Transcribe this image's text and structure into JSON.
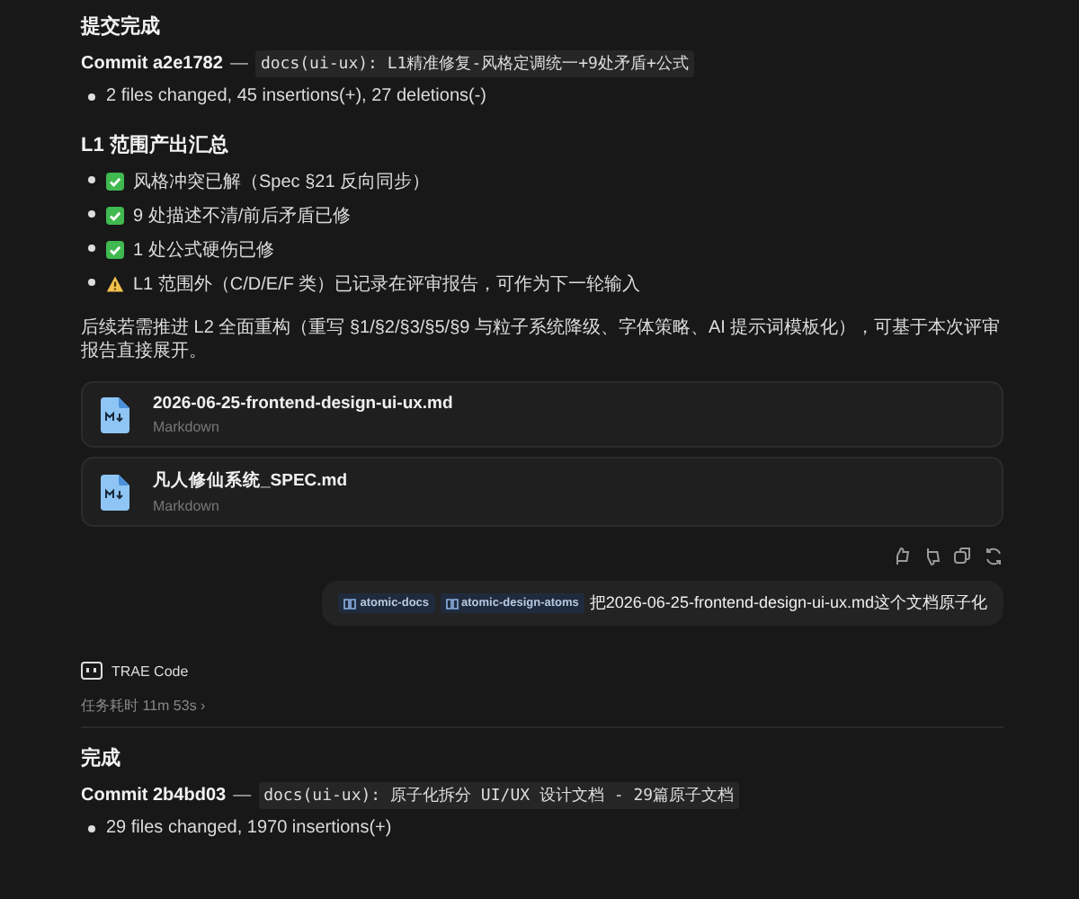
{
  "sections": [
    {
      "heading": "提交完成",
      "commit": {
        "label": "Commit a2e1782",
        "dash": "—",
        "message": "docs(ui-ux): L1精准修复-风格定调统一+9处矛盾+公式"
      },
      "stats": [
        "2 files changed, 45 insertions(+), 27 deletions(-)"
      ]
    }
  ],
  "summary": {
    "heading": "L1 范围产出汇总",
    "items": [
      {
        "kind": "done",
        "text": "风格冲突已解（Spec §21 反向同步）"
      },
      {
        "kind": "done",
        "text": "9 处描述不清/前后矛盾已修"
      },
      {
        "kind": "done",
        "text": "1 处公式硬伤已修"
      },
      {
        "kind": "warning",
        "text": "L1 范围外（C/D/E/F 类）已记录在评审报告，可作为下一轮输入"
      }
    ],
    "note": "后续若需推进 L2 全面重构（重写 §1/§2/§3/§5/§9 与粒子系统降级、字体策略、AI 提示词模板化），可基于本次评审报告直接展开。"
  },
  "files": [
    {
      "name": "2026-06-25-frontend-design-ui-ux.md",
      "type": "Markdown"
    },
    {
      "name": "凡人修仙系统_SPEC.md",
      "type": "Markdown"
    }
  ],
  "user_message": {
    "tags": [
      "atomic-docs",
      "atomic-design-atoms"
    ],
    "text": "把2026-06-25-frontend-design-ui-ux.md这个文档原子化"
  },
  "agent": {
    "name": "TRAE Code",
    "duration": "任务耗时 11m 53s",
    "expand": "›"
  },
  "result": {
    "heading": "完成",
    "commit": {
      "label": "Commit 2b4bd03",
      "dash": "—",
      "message": "docs(ui-ux): 原子化拆分 UI/UX 设计文档 - 29篇原子文档"
    },
    "stats": [
      "29 files changed, 1970 insertions(+)"
    ]
  }
}
